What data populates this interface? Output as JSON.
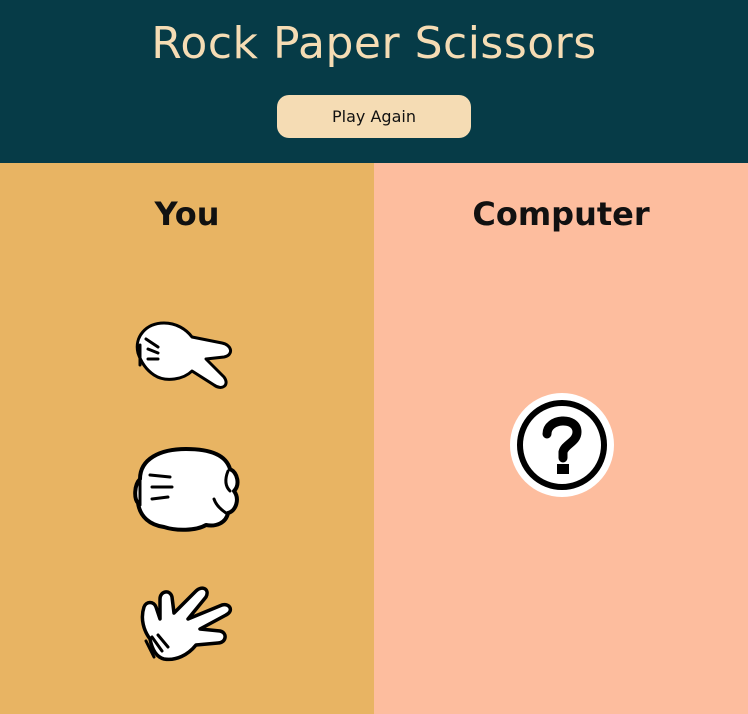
{
  "header": {
    "title": "Rock Paper Scissors",
    "play_again_label": "Play Again"
  },
  "you": {
    "title": "You",
    "choices": [
      {
        "name": "scissors",
        "icon": "scissors-hand-icon"
      },
      {
        "name": "rock",
        "icon": "rock-fist-icon"
      },
      {
        "name": "paper",
        "icon": "paper-hand-icon"
      }
    ]
  },
  "computer": {
    "title": "Computer",
    "choice_icon": "question-mark-icon"
  },
  "colors": {
    "header_bg": "#063b47",
    "accent": "#f5dcb4",
    "you_bg": "#e8b463",
    "computer_bg": "#fdbd9e"
  }
}
